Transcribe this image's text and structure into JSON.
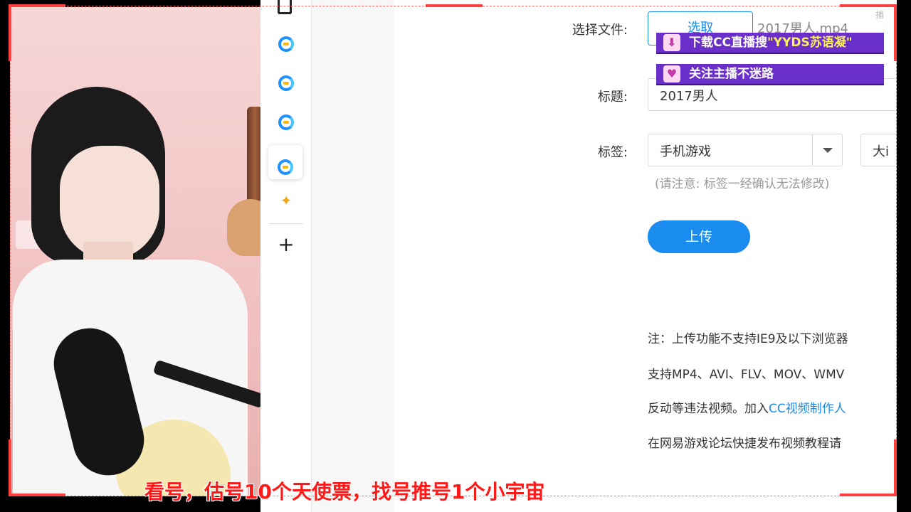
{
  "form": {
    "file_label": "选择文件:",
    "select_button": "选取",
    "file_name": "2017男人.mp4",
    "title_label": "标题:",
    "title_value": "2017男人",
    "tag_label": "标签:",
    "tag_value": "手机游戏",
    "tag2_value": "大i",
    "tag_hint": "(请注意: 标签一经确认无法修改)",
    "upload_button": "上传"
  },
  "notes": {
    "line1": "注：上传功能不支持IE9及以下浏览器",
    "line2": "支持MP4、AVI、FLV、MOV、WMV",
    "line3_prefix": "反动等违法视频。加入",
    "line3_link": "CC视频制作人",
    "line4": "在网易游戏论坛快捷发布视频教程请"
  },
  "overlay": {
    "banner1_prefix": "下载CC直播搜",
    "banner1_highlight": "\"YYDS苏语凝\"",
    "banner2": "关注主播不迷路",
    "caption": "看号，估号10个天使票，找号推号1个小宇宙",
    "watermark": "播"
  },
  "sidebar": {
    "plus_label": "+"
  },
  "colors": {
    "accent": "#1a8cf0",
    "banner": "#6b2fc9",
    "caption": "#ff1a1a"
  }
}
